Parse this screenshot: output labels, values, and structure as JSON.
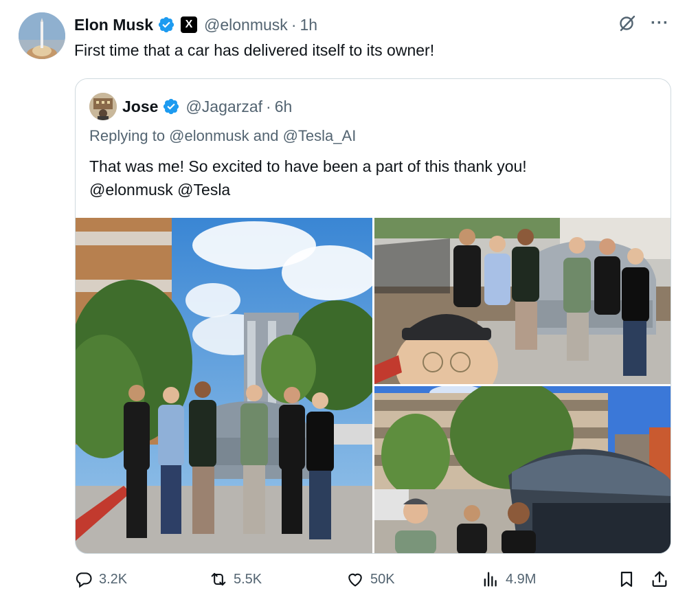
{
  "tweet": {
    "author": {
      "name": "Elon Musk",
      "handle": "@elonmusk",
      "time": "1h",
      "separator": "·",
      "verified": true,
      "affiliate_badge": "X"
    },
    "text": "First time that a car has delivered itself to its owner!",
    "top_icons": [
      "grok-icon",
      "more-icon"
    ],
    "more_label": "···"
  },
  "quote": {
    "author": {
      "name": "Jose",
      "handle": "@Jagarzaf",
      "time": "6h",
      "separator": "·",
      "verified": true
    },
    "replying_to": "Replying to @elonmusk and @Tesla_AI",
    "text_line1": "That was me! So excited to have been a part of this thank you!",
    "text_line2": "@elonmusk @Tesla",
    "media": [
      {
        "name": "group-photo-with-cybercab"
      },
      {
        "name": "selfie-with-group-and-car"
      },
      {
        "name": "car-open-trunk-at-apartments"
      }
    ]
  },
  "actions": {
    "replies": "3.2K",
    "reposts": "5.5K",
    "likes": "50K",
    "views": "4.9M"
  },
  "colors": {
    "text": "#0f1419",
    "secondary": "#536471",
    "verified_blue": "#1d9bf0",
    "border": "#cfd9de"
  }
}
